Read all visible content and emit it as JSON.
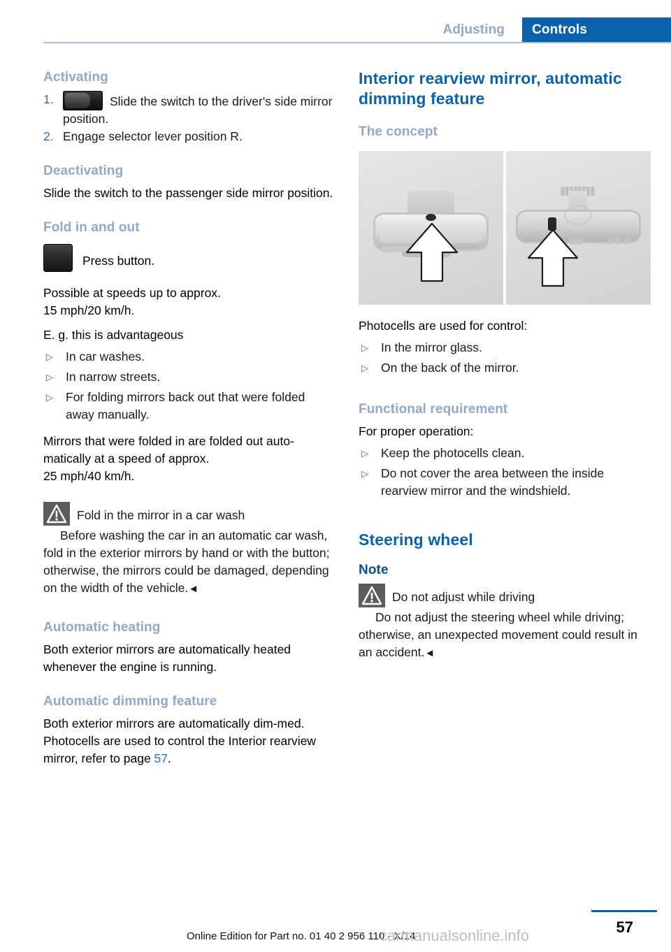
{
  "header": {
    "chapter": "Adjusting",
    "section": "Controls"
  },
  "left_column": {
    "activating": {
      "heading": "Activating",
      "steps": [
        {
          "num": "1.",
          "icon": "rocker-switch-icon",
          "text": "Slide the switch to the driver's side mirror position."
        },
        {
          "num": "2.",
          "icon": "",
          "text": "Engage selector lever position R."
        }
      ]
    },
    "deactivating": {
      "heading": "Deactivating",
      "text": "Slide the switch to the passenger side mirror position."
    },
    "fold": {
      "heading": "Fold in and out",
      "button_icon": "press-button-icon",
      "button_text": "Press button.",
      "speed_note": "Possible at speeds up to approx.\n15 mph/20 km/h.",
      "examples_intro": "E. g. this is advantageous",
      "examples": [
        "In car washes.",
        "In narrow streets.",
        "For folding mirrors back out that were folded away manually."
      ],
      "auto_unfold": "Mirrors that were folded in are folded out auto-matically at a speed of approx.\n25 mph/40 km/h."
    },
    "warning": {
      "icon": "warning-triangle-icon",
      "title": "Fold in the mirror in a car wash",
      "body": "Before washing the car in an automatic car wash, fold in the exterior mirrors by hand or with the button; otherwise, the mirrors could be damaged, depending on the width of the vehicle.",
      "end_marker": "◄"
    },
    "auto_heating": {
      "heading": "Automatic heating",
      "text": "Both exterior mirrors are automatically heated whenever the engine is running."
    },
    "auto_dimming": {
      "heading": "Automatic dimming feature",
      "text_before": "Both exterior mirrors are automatically dim-med. Photocells are used to control the Interior rearview mirror, refer to page ",
      "page_ref": "57",
      "text_after": "."
    }
  },
  "right_column": {
    "main_heading": "Interior rearview mirror, automatic dimming feature",
    "concept": {
      "heading": "The concept",
      "figure": {
        "name": "rearview-mirror-photocell-figure",
        "left_image_alt": "mirror-front-view-photocell",
        "right_image_alt": "mirror-rear-view-photocell"
      },
      "intro": "Photocells are used for control:",
      "bullets": [
        "In the mirror glass.",
        "On the back of the mirror."
      ]
    },
    "functional": {
      "heading": "Functional requirement",
      "intro": "For proper operation:",
      "bullets": [
        "Keep the photocells clean.",
        "Do not cover the area between the inside rearview mirror and the windshield."
      ]
    },
    "steering": {
      "heading": "Steering wheel",
      "note_heading": "Note",
      "warning": {
        "icon": "warning-triangle-icon",
        "title": "Do not adjust while driving",
        "body": "Do not adjust the steering wheel while driving; otherwise, an unexpected movement could result in an accident.",
        "end_marker": "◄"
      }
    }
  },
  "footer": {
    "edition_line": "Online Edition for Part no. 01 40 2 956 110 - X/14",
    "watermark": "carmanualsonline.info",
    "page_number": "57"
  },
  "colors": {
    "brand_blue": "#0b62ab",
    "heading_light_blue": "#8fa8cc",
    "link_blue": "#2f6fb5",
    "header_rule": "#a9bedd",
    "warning_gray": "#5c5c5c"
  }
}
